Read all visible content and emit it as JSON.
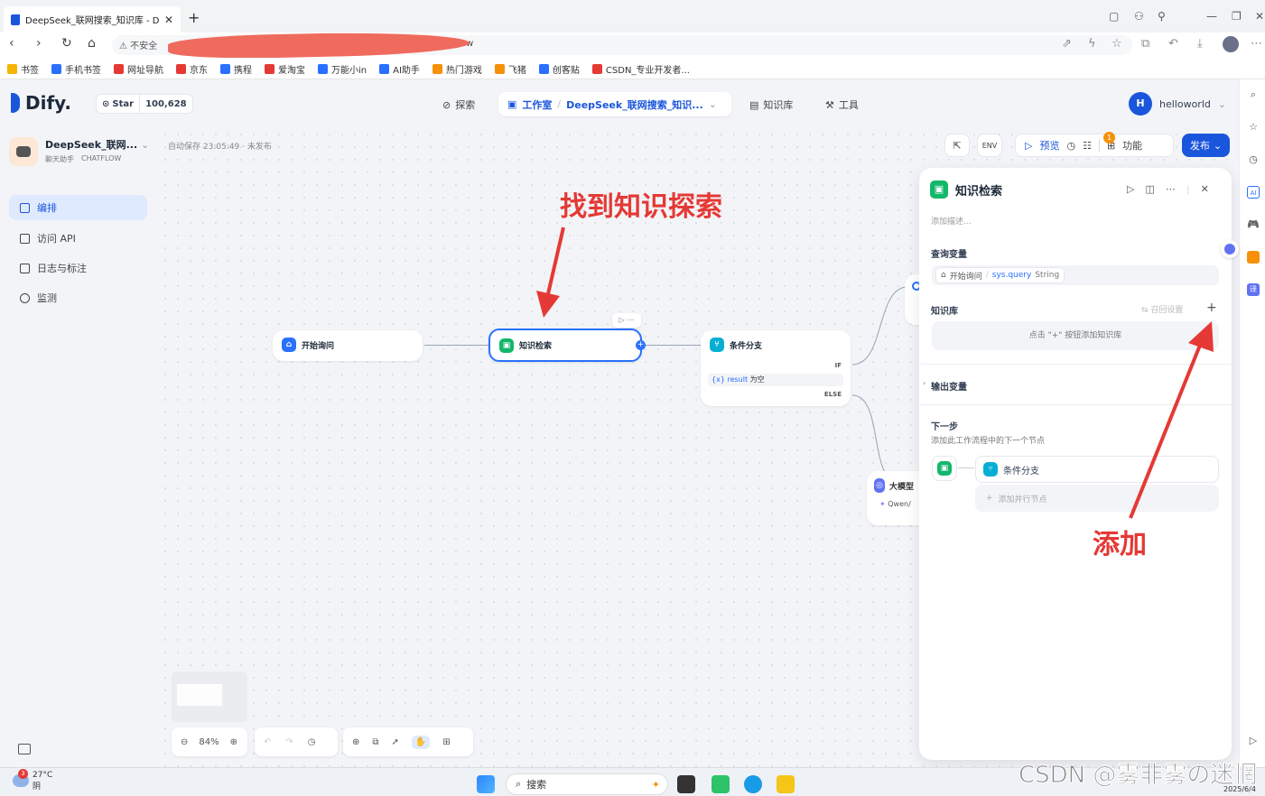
{
  "browser": {
    "tab_title": "DeepSeek_联网搜索_知识库 - Di",
    "address_prefix": "不安全",
    "address_suffix": "ow",
    "bookmarks": [
      {
        "label": "书签",
        "color": "#f5b400"
      },
      {
        "label": "手机书签",
        "color": "#2970ff"
      },
      {
        "label": "网址导航",
        "color": "#e53935"
      },
      {
        "label": "京东",
        "color": "#e53935"
      },
      {
        "label": "携程",
        "color": "#2970ff"
      },
      {
        "label": "爱淘宝",
        "color": "#e53935"
      },
      {
        "label": "万能小in",
        "color": "#2970ff"
      },
      {
        "label": "AI助手",
        "color": "#2970ff"
      },
      {
        "label": "热门游戏",
        "color": "#f79009"
      },
      {
        "label": "飞猪",
        "color": "#f79009"
      },
      {
        "label": "创客贴",
        "color": "#2970ff"
      },
      {
        "label": "CSDN_专业开发者...",
        "color": "#e53935"
      }
    ]
  },
  "header": {
    "logo": "Dify.",
    "star_label": "Star",
    "star_count": "100,628",
    "nav_explore": "探索",
    "nav_studio": "工作室",
    "nav_app": "DeepSeek_联网搜索_知识...",
    "nav_knowledge": "知识库",
    "nav_tools": "工具",
    "user_initial": "H",
    "user_name": "helloworld"
  },
  "sidebar": {
    "app_name": "DeepSeek_联网...",
    "app_type": "聊天助手",
    "app_mode": "CHATFLOW",
    "menu": [
      "编排",
      "访问 API",
      "日志与标注",
      "监测"
    ]
  },
  "canvas": {
    "autosave": "自动保存 23:05:49 · 未发布",
    "toolbar_preview": "预览",
    "toolbar_badge": "1",
    "toolbar_features": "功能",
    "publish": "发布",
    "nodes": {
      "start": "开始询问",
      "knowledge": "知识检索",
      "ifelse": "条件分支",
      "ifelse_if": "IF",
      "ifelse_cond_var": "{x} result",
      "ifelse_cond_op": "为空",
      "ifelse_else": "ELSE",
      "llm": "大模型",
      "llm_model": "Qwen/"
    },
    "zoom": "84%"
  },
  "panel": {
    "title": "知识检索",
    "desc_placeholder": "添加描述...",
    "query_label": "查询变量",
    "query_chip_node": "开始询问",
    "query_chip_var": "sys.query",
    "query_chip_type": "String",
    "kb_label": "知识库",
    "kb_recall": "召回设置",
    "kb_hint": "点击 \"+\" 按钮添加知识库",
    "output_label": "输出变量",
    "next_label": "下一步",
    "next_desc": "添加此工作流程中的下一个节点",
    "next_node": "条件分支",
    "add_parallel": "添加并行节点"
  },
  "annotations": {
    "find": "找到知识探索",
    "add": "添加"
  },
  "taskbar": {
    "badge": "3",
    "temp": "27°C",
    "weather": "阴",
    "search": "搜索",
    "watermark": "CSDN @雾非雾の迷惘",
    "date": "2025/6/4"
  }
}
